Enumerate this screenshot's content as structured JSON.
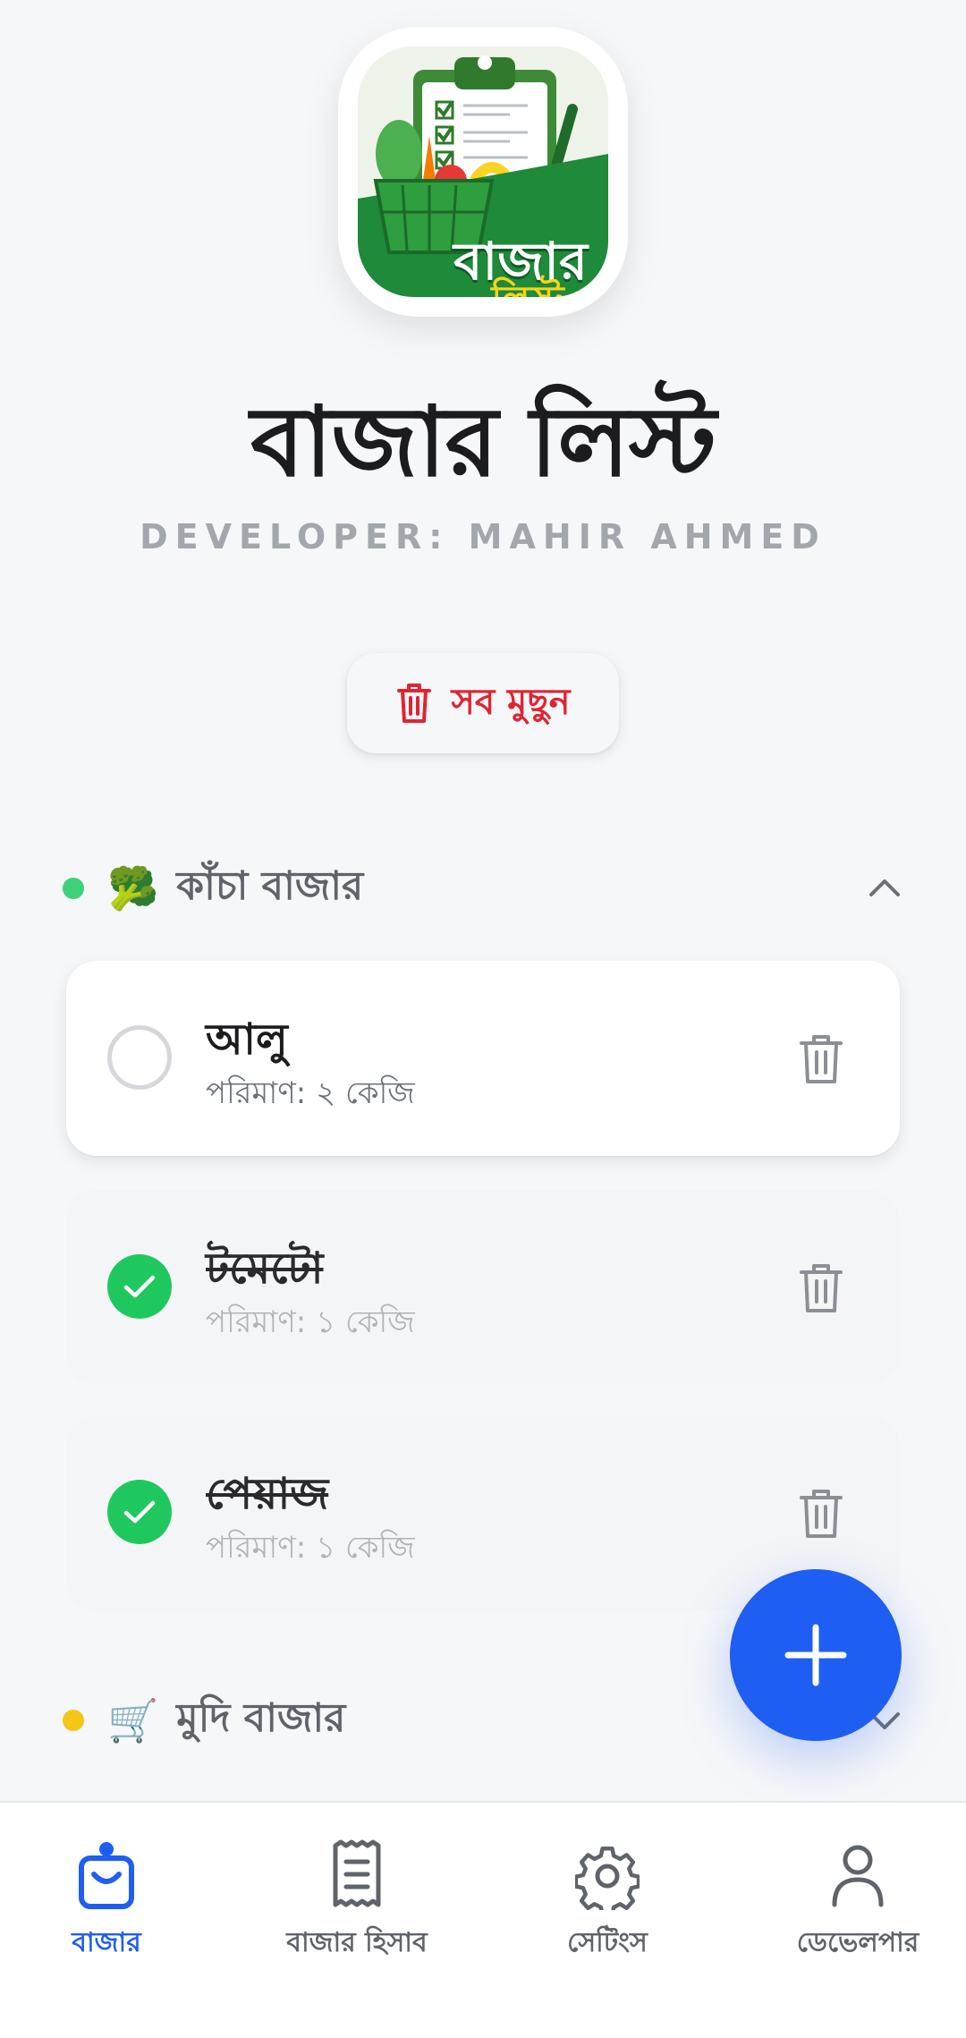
{
  "app": {
    "logo_line1": "বাজার",
    "logo_line2": "লিস্ট",
    "title": "বাজার লিস্ট",
    "developer": "DEVELOPER: MAHIR AHMED"
  },
  "actions": {
    "clear_all": "সব মুছুন"
  },
  "sections": [
    {
      "emoji": "🥦",
      "title": "কাঁচা বাজার",
      "dot_color": "#3fd17a",
      "expanded": true,
      "items": [
        {
          "name": "আলু",
          "qty": "পরিমাণ: ২ কেজি",
          "done": false
        },
        {
          "name": "টমেটো",
          "qty": "পরিমাণ: ১ কেজি",
          "done": true
        },
        {
          "name": "পেয়াজ",
          "qty": "পরিমাণ: ১ কেজি",
          "done": true
        }
      ]
    },
    {
      "emoji": "🛒",
      "title": "মুদি বাজার",
      "dot_color": "#f5c518",
      "expanded": false,
      "items": []
    }
  ],
  "fab": {
    "icon": "plus-icon"
  },
  "nav": [
    {
      "label": "বাজার",
      "icon": "shopping-bag-icon",
      "active": true
    },
    {
      "label": "বাজার হিসাব",
      "icon": "receipt-icon",
      "active": false
    },
    {
      "label": "সেটিংস",
      "icon": "gear-icon",
      "active": false
    },
    {
      "label": "ডেভেলপার",
      "icon": "user-icon",
      "active": false
    }
  ],
  "colors": {
    "accent": "#1f5ef2",
    "danger": "#e02432",
    "success": "#1fc85e",
    "background": "#f6f7f9"
  }
}
